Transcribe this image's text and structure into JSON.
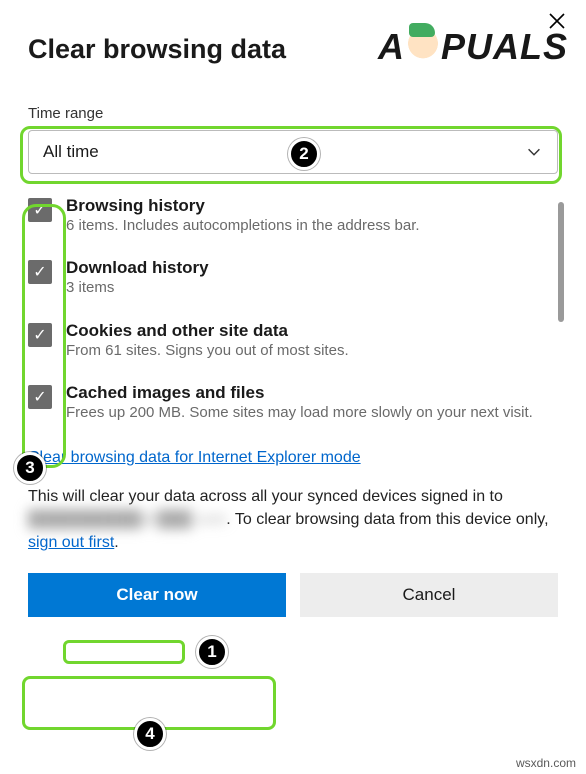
{
  "dialog": {
    "title": "Clear browsing data",
    "time_range_label": "Time range",
    "time_range_value": "All time"
  },
  "items": [
    {
      "title": "Browsing history",
      "desc": "6 items. Includes autocompletions in the address bar.",
      "checked": true
    },
    {
      "title": "Download history",
      "desc": "3 items",
      "checked": true
    },
    {
      "title": "Cookies and other site data",
      "desc": "From 61 sites. Signs you out of most sites.",
      "checked": true
    },
    {
      "title": "Cached images and files",
      "desc": "Frees up 200 MB. Some sites may load more slowly on your next visit.",
      "checked": true
    }
  ],
  "links": {
    "ie_mode": "Clear browsing data for Internet Explorer mode",
    "sign_out": "sign out first"
  },
  "info": {
    "part1": "This will clear your data across all your synced devices signed in to ",
    "redacted": "██████████@███.com",
    "part2": ". To clear browsing data from this device only, ",
    "period": "."
  },
  "buttons": {
    "primary": "Clear now",
    "secondary": "Cancel"
  },
  "annotations": {
    "badge1": "1",
    "badge2": "2",
    "badge3": "3",
    "badge4": "4"
  },
  "watermark": {
    "left": "A",
    "right": "PUALS"
  },
  "source": "wsxdn.com"
}
